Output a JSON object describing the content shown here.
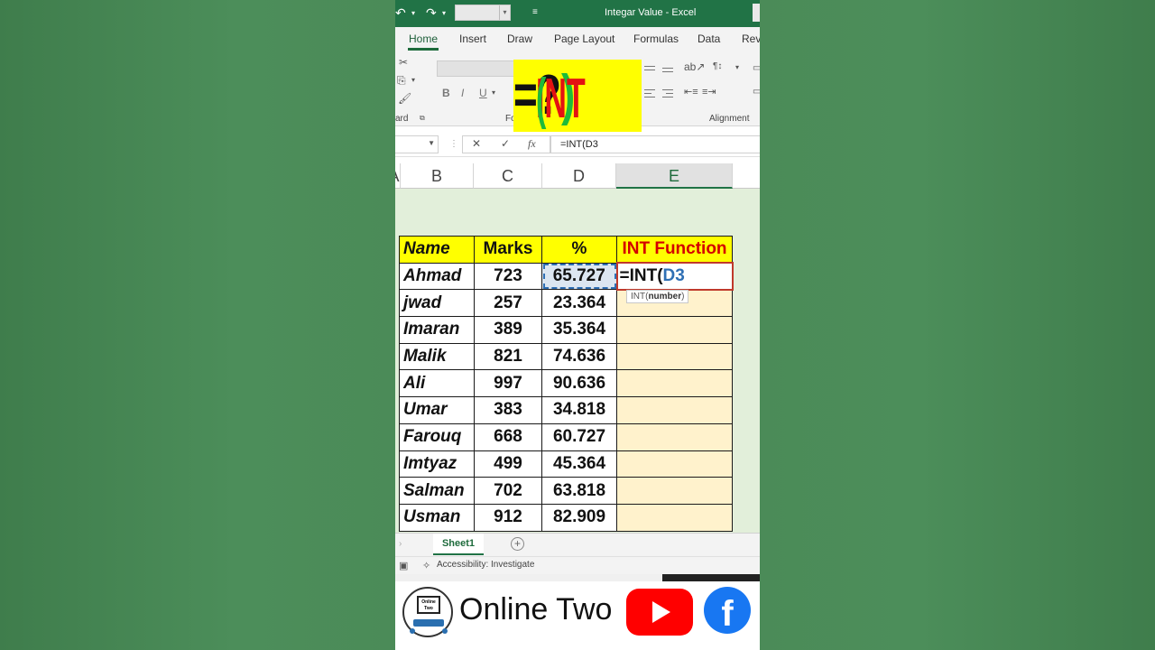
{
  "window": {
    "title": "Integar Value  -  Excel"
  },
  "ribbon": {
    "tabs": [
      "Home",
      "Insert",
      "Draw",
      "Page Layout",
      "Formulas",
      "Data",
      "Revi"
    ],
    "active_tab": "Home",
    "clipboard_label": "ard",
    "font_label": "Fo",
    "alignment_label": "Alignment",
    "format_buttons": [
      "B",
      "I",
      "U"
    ]
  },
  "overlay": {
    "eq": "=",
    "word": "INT",
    "open": "(",
    "question": "?",
    "close": ")"
  },
  "formula_bar": {
    "cancel": "✕",
    "enter": "✓",
    "fx": "fx",
    "formula": "=INT(D3"
  },
  "columns": [
    "A",
    "B",
    "C",
    "D",
    "E"
  ],
  "selected_column": "E",
  "table": {
    "headers": {
      "name": "Name",
      "marks": "Marks",
      "pct": "%",
      "int": "INT Function"
    },
    "rows": [
      {
        "name": "Ahmad",
        "marks": "723",
        "pct": "65.727"
      },
      {
        "name": "jwad",
        "marks": "257",
        "pct": "23.364"
      },
      {
        "name": "Imaran",
        "marks": "389",
        "pct": "35.364"
      },
      {
        "name": "Malik",
        "marks": "821",
        "pct": "74.636"
      },
      {
        "name": "Ali",
        "marks": "997",
        "pct": "90.636"
      },
      {
        "name": "Umar",
        "marks": "383",
        "pct": "34.818"
      },
      {
        "name": "Farouq",
        "marks": "668",
        "pct": "60.727"
      },
      {
        "name": "Imtyaz",
        "marks": "499",
        "pct": "45.364"
      },
      {
        "name": "Salman",
        "marks": "702",
        "pct": "63.818"
      },
      {
        "name": "Usman",
        "marks": "912",
        "pct": "82.909"
      }
    ],
    "editing_prefix": "=INT(",
    "editing_ref": "D3"
  },
  "tooltip": {
    "fn": "INT(",
    "arg": "number",
    "close": ")"
  },
  "sheet_tabs": {
    "active": "Sheet1",
    "add": "+"
  },
  "status_bar": {
    "accessibility": "Accessibility: Investigate"
  },
  "footer": {
    "logo_text": "Online Two",
    "brand": "Online Two",
    "facebook": "f"
  },
  "colors": {
    "excel_green": "#217346",
    "header_yellow": "#ffff00",
    "int_header_red": "#d40000",
    "sheet_bg": "#e2efda",
    "int_col_bg": "#fff2cc",
    "youtube_red": "#ff0000",
    "facebook_blue": "#1877f2"
  },
  "icons": [
    "undo-icon",
    "redo-icon",
    "customize-qat-icon",
    "cut-icon",
    "copy-icon",
    "format-painter-icon",
    "cancel-icon",
    "enter-icon",
    "fx-icon",
    "add-sheet-icon",
    "accessibility-icon",
    "youtube-icon",
    "facebook-icon"
  ]
}
